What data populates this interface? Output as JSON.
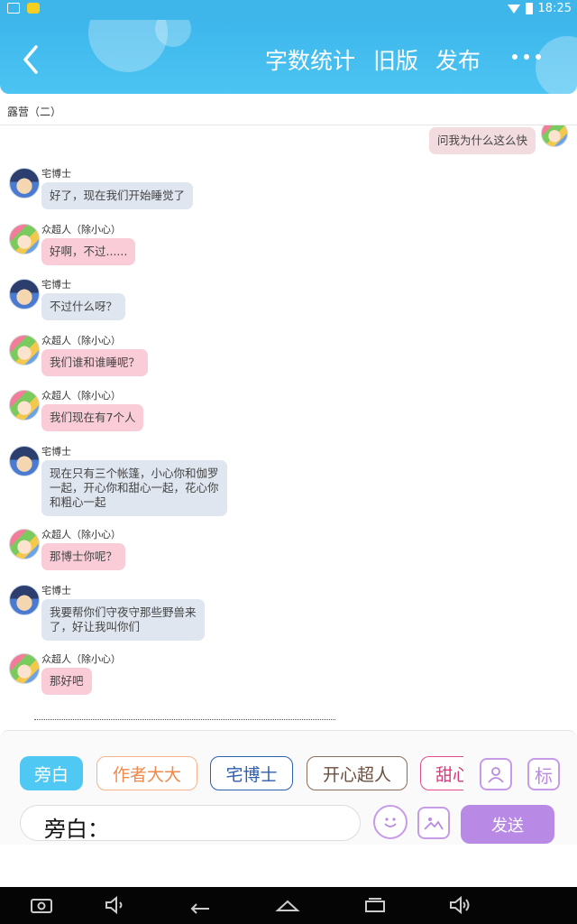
{
  "status_bar": {
    "time": "18:25"
  },
  "header": {
    "back_icon": "chevron-left-icon",
    "actions": {
      "word_count": "字数统计",
      "old_version": "旧版",
      "publish": "发布"
    },
    "more_icon": "more-dots-icon"
  },
  "doc_title": "露营（二）",
  "messages": [
    {
      "side": "right",
      "text": "问我为什么这么快"
    },
    {
      "side": "left",
      "sender": "宅博士",
      "lines": [
        "好了，现在我们开始睡觉了"
      ],
      "color": "blue"
    },
    {
      "side": "left",
      "sender": "众超人（除小心）",
      "lines": [
        "好啊，不过......"
      ],
      "color": "pink"
    },
    {
      "side": "left",
      "sender": "宅博士",
      "lines": [
        "不过什么呀？"
      ],
      "color": "blue"
    },
    {
      "side": "left",
      "sender": "众超人（除小心）",
      "lines": [
        "我们谁和谁睡呢？"
      ],
      "color": "pink"
    },
    {
      "side": "left",
      "sender": "众超人（除小心）",
      "lines": [
        "我们现在有7个人"
      ],
      "color": "pink"
    },
    {
      "side": "left",
      "sender": "宅博士",
      "lines": [
        "现在只有三个帐篷，小心你和伽罗",
        "一起，开心你和甜心一起，花心你",
        "和粗心一起"
      ],
      "color": "blue"
    },
    {
      "side": "left",
      "sender": "众超人（除小心）",
      "lines": [
        "那博士你呢？"
      ],
      "color": "pink"
    },
    {
      "side": "left",
      "sender": "宅博士",
      "lines": [
        "我要帮你们守夜守那些野兽来",
        "了，好让我叫你们"
      ],
      "color": "blue"
    },
    {
      "side": "left",
      "sender": "众超人（除小心）",
      "lines": [
        "那好吧"
      ],
      "color": "pink"
    }
  ],
  "roles": {
    "narrator": "旁白",
    "author": "作者大大",
    "doctor": "宅博士",
    "happy": "开心超人",
    "sweet": "甜心"
  },
  "role_buttons": {
    "add_role_icon": "person-icon",
    "mark": "标"
  },
  "input": {
    "prefix": "旁白："
  },
  "toolbar": {
    "emoji_icon": "smile-icon",
    "image_icon": "image-icon",
    "send": "发送"
  },
  "nav_icons": [
    "screenshot-icon",
    "volume-down-icon",
    "back-icon",
    "home-icon",
    "recents-icon",
    "volume-up-icon"
  ],
  "colors": {
    "accent": "#3fb6ea",
    "send": "#b88ae6",
    "bubble_blue": "#dfe6ef",
    "bubble_pink": "#f9ccd8"
  }
}
